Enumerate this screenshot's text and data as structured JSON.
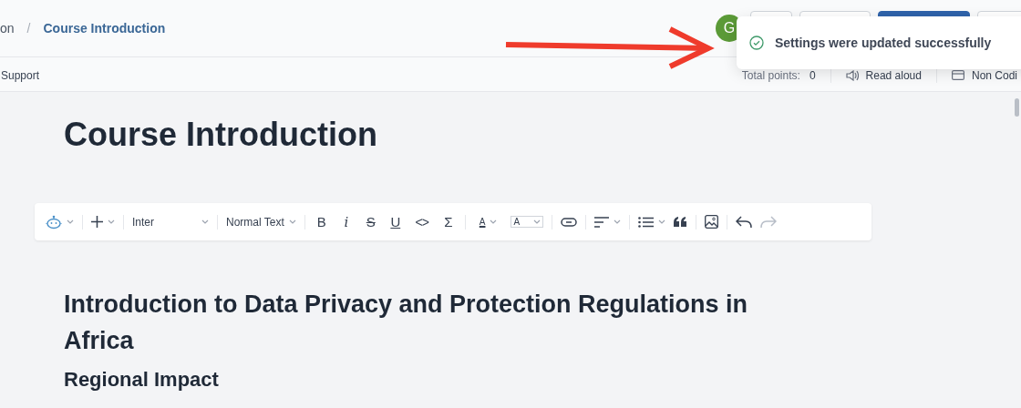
{
  "breadcrumb": {
    "parent": "on",
    "separator": "/",
    "current": "Course Introduction"
  },
  "header": {
    "avatar": "G",
    "buttons": [
      {
        "kind": "outline"
      },
      {
        "kind": "outline"
      },
      {
        "kind": "primary"
      },
      {
        "kind": "outline"
      }
    ]
  },
  "toast": {
    "message": "Settings were updated successfully"
  },
  "subbar": {
    "left": "Support",
    "total_label": "Total points:",
    "total_value": "0",
    "read_aloud": "Read aloud",
    "mode": "Non Codi"
  },
  "page_title": "Course Introduction",
  "toolbar": [
    {
      "kind": "icon",
      "disabled": false
    },
    {
      "kind": "divider"
    },
    {
      "kind": "icon",
      "disabled": false
    },
    {
      "kind": "divider"
    },
    {
      "kind": "select",
      "label": "Inter"
    },
    {
      "kind": "divider"
    },
    {
      "kind": "select",
      "label": "Normal Text"
    },
    {
      "kind": "divider"
    },
    {
      "kind": "char",
      "label": "B",
      "disabled": false
    },
    {
      "kind": "char",
      "label": "i",
      "disabled": false
    },
    {
      "kind": "char",
      "label": "S",
      "disabled": false
    },
    {
      "kind": "char",
      "label": "U",
      "disabled": false
    },
    {
      "kind": "char",
      "label": "<>",
      "disabled": false
    },
    {
      "kind": "char",
      "label": "Σ",
      "disabled": false
    },
    {
      "kind": "divider"
    },
    {
      "kind": "color",
      "label": "A",
      "disabled": false
    },
    {
      "kind": "color",
      "label": "A",
      "disabled": false
    },
    {
      "kind": "divider"
    },
    {
      "kind": "icon",
      "disabled": false
    },
    {
      "kind": "divider"
    },
    {
      "kind": "icon",
      "disabled": false
    },
    {
      "kind": "divider"
    },
    {
      "kind": "icon",
      "disabled": false
    },
    {
      "kind": "icon",
      "disabled": false
    },
    {
      "kind": "divider"
    },
    {
      "kind": "icon",
      "disabled": false
    },
    {
      "kind": "divider"
    },
    {
      "kind": "icon",
      "disabled": false
    },
    {
      "kind": "icon",
      "disabled": true
    }
  ],
  "content": [
    {
      "kind": "h2",
      "text": "Introduction to Data Privacy and Protection Regulations in Africa"
    },
    {
      "kind": "h3",
      "text": "Regional Impact"
    }
  ]
}
